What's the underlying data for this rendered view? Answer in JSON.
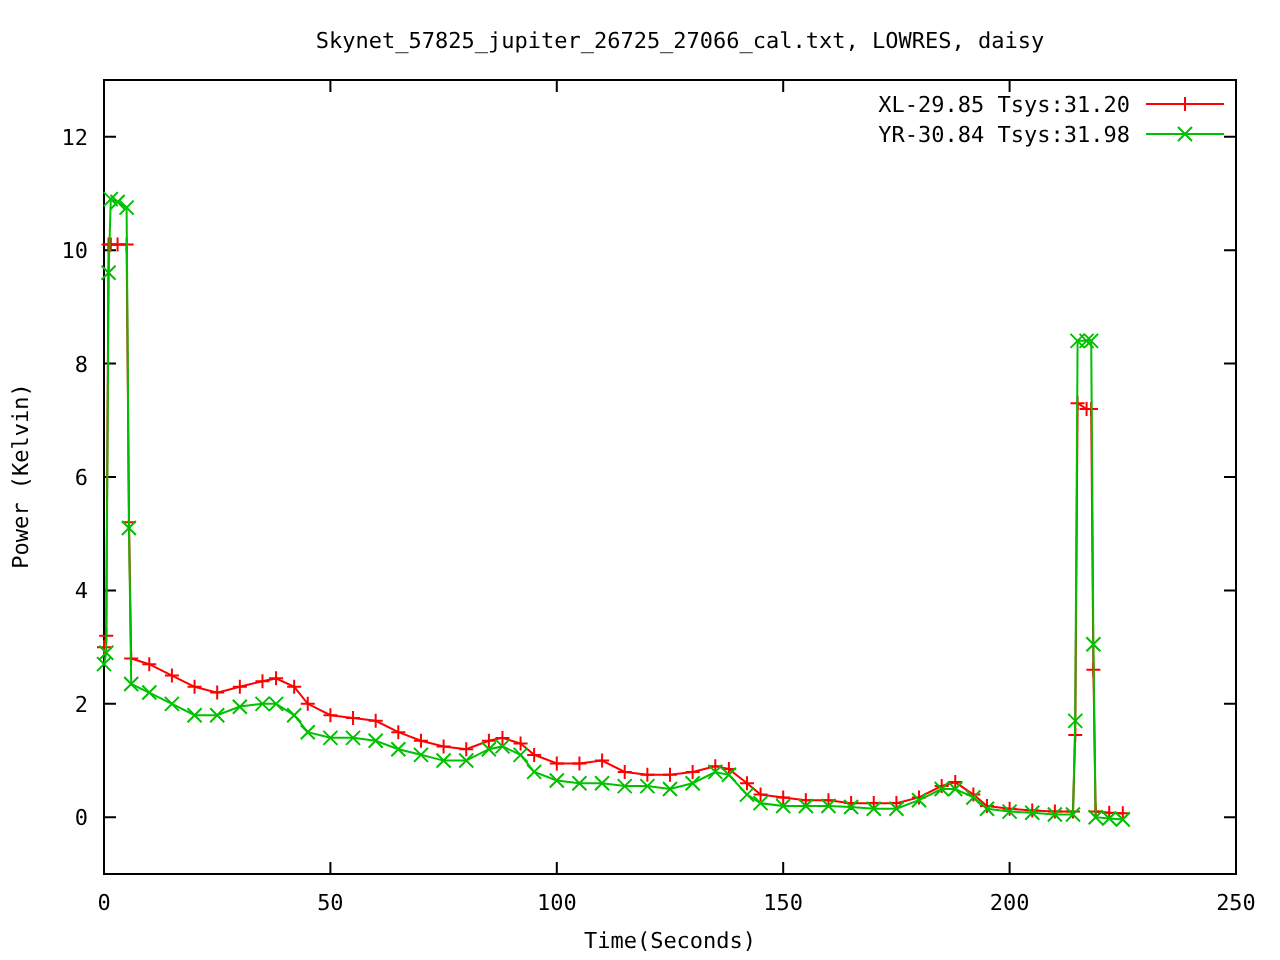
{
  "chart_data": {
    "type": "line",
    "title": "Skynet_57825_jupiter_26725_27066_cal.txt, LOWRES, daisy",
    "xlabel": "Time(Seconds)",
    "ylabel": "Power (Kelvin)",
    "x": [
      0,
      0.5,
      1,
      1.5,
      3,
      5,
      5.5,
      6,
      10,
      15,
      20,
      25,
      30,
      35,
      38,
      42,
      45,
      50,
      55,
      60,
      65,
      70,
      75,
      80,
      85,
      88,
      92,
      95,
      100,
      105,
      110,
      115,
      120,
      125,
      130,
      135,
      138,
      142,
      145,
      150,
      155,
      160,
      165,
      170,
      175,
      180,
      185,
      188,
      192,
      195,
      200,
      205,
      210,
      214,
      214.5,
      215,
      217,
      218,
      218.5,
      219,
      222,
      225
    ],
    "series": [
      {
        "name": "XL-29.85 Tsys:31.20",
        "color": "#ff0000",
        "marker": "plus",
        "values": [
          3.0,
          3.2,
          10.1,
          10.1,
          10.1,
          10.1,
          5.2,
          2.8,
          2.7,
          2.5,
          2.3,
          2.2,
          2.3,
          2.4,
          2.45,
          2.3,
          2.0,
          1.8,
          1.75,
          1.7,
          1.5,
          1.35,
          1.25,
          1.2,
          1.35,
          1.4,
          1.3,
          1.1,
          0.95,
          0.95,
          1.0,
          0.8,
          0.75,
          0.75,
          0.8,
          0.9,
          0.85,
          0.6,
          0.4,
          0.35,
          0.3,
          0.3,
          0.25,
          0.25,
          0.25,
          0.35,
          0.55,
          0.62,
          0.4,
          0.2,
          0.15,
          0.12,
          0.1,
          0.1,
          1.45,
          7.3,
          7.2,
          7.2,
          2.6,
          0.1,
          0.08,
          0.07
        ]
      },
      {
        "name": "YR-30.84 Tsys:31.98",
        "color": "#00c000",
        "marker": "cross",
        "values": [
          2.7,
          2.9,
          9.6,
          10.9,
          10.85,
          10.75,
          5.1,
          2.35,
          2.2,
          2.0,
          1.8,
          1.8,
          1.95,
          2.0,
          2.0,
          1.8,
          1.5,
          1.4,
          1.4,
          1.35,
          1.2,
          1.1,
          1.0,
          1.0,
          1.2,
          1.25,
          1.1,
          0.8,
          0.65,
          0.6,
          0.6,
          0.55,
          0.55,
          0.5,
          0.6,
          0.8,
          0.75,
          0.4,
          0.25,
          0.2,
          0.2,
          0.2,
          0.18,
          0.15,
          0.15,
          0.3,
          0.5,
          0.5,
          0.35,
          0.15,
          0.1,
          0.08,
          0.05,
          0.05,
          1.7,
          8.4,
          8.4,
          8.4,
          3.05,
          0.0,
          -0.02,
          -0.04
        ]
      }
    ],
    "legend": "top right",
    "xlim": [
      0,
      250
    ],
    "ylim": [
      -1,
      13
    ],
    "xticks": [
      0,
      50,
      100,
      150,
      200,
      250
    ],
    "yticks": [
      0,
      2,
      4,
      6,
      8,
      10,
      12
    ]
  }
}
